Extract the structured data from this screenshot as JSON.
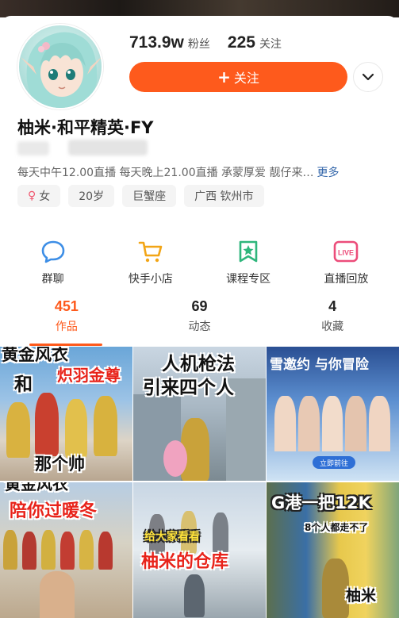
{
  "profile": {
    "fans_count": "713.9w",
    "fans_label": "粉丝",
    "following_count": "225",
    "following_label": "关注",
    "follow_button_label": "关注",
    "name": "柚米·和平精英·FY",
    "bio": "每天中午12.00直播 每天晚上21.00直播 承蒙厚爱 靓仔来…",
    "bio_more": "更多",
    "tags": {
      "gender_symbol": "♀",
      "gender": "女",
      "age": "20岁",
      "zodiac": "巨蟹座",
      "location": "广西 钦州市"
    }
  },
  "services": [
    {
      "label": "群聊",
      "icon": "chat-icon"
    },
    {
      "label": "快手小店",
      "icon": "shop-cart-icon"
    },
    {
      "label": "课程专区",
      "icon": "course-star-icon"
    },
    {
      "label": "直播回放",
      "icon": "live-replay-icon"
    }
  ],
  "tabs": [
    {
      "count": "451",
      "label": "作品",
      "active": true
    },
    {
      "count": "69",
      "label": "动态",
      "active": false
    },
    {
      "count": "4",
      "label": "收藏",
      "active": false
    }
  ],
  "videos": [
    {
      "caption_1": "黄金风衣",
      "caption_2": "和",
      "caption_3": "炽羽金尊",
      "caption_4": "那个帅"
    },
    {
      "caption_1": "人机枪法",
      "caption_2": "引来四个人"
    },
    {
      "caption_1": "雪邀约 与你冒险",
      "caption_2": "立即前往"
    },
    {
      "caption_1": "黄金风衣",
      "caption_2": "陪你过暖冬"
    },
    {
      "caption_1": "给大家看看",
      "caption_2": "柚米的仓库"
    },
    {
      "caption_1": "G港一把12K",
      "caption_2": "8个人都走不了",
      "caption_3": "柚米"
    }
  ],
  "colors": {
    "accent": "#fe5a1c",
    "chat": "#3d8ee6",
    "shop": "#f2a516",
    "course": "#2fb67c",
    "live": "#ec4d7a"
  }
}
